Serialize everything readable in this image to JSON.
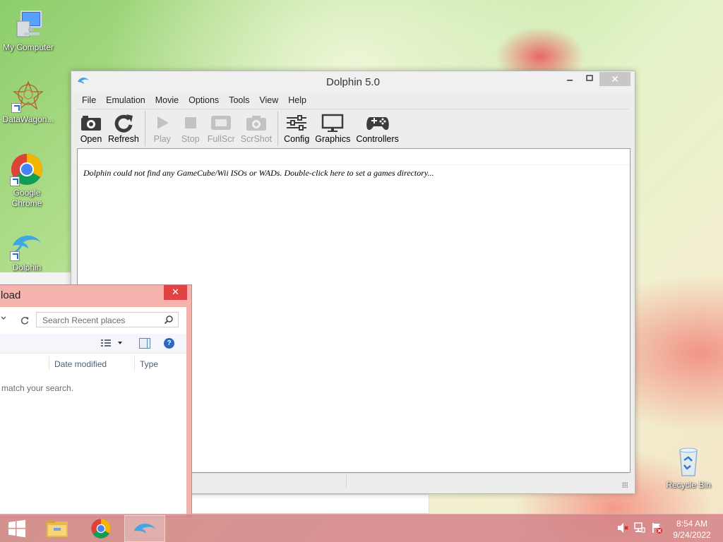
{
  "desktop": {
    "icons": [
      {
        "label": "My Computer"
      },
      {
        "label": "DataWagon..."
      },
      {
        "label": "Google Chrome"
      },
      {
        "label": "Dolphin"
      },
      {
        "label": "Recycle Bin"
      }
    ]
  },
  "dolphin_window": {
    "title": "Dolphin 5.0",
    "menu": [
      "File",
      "Emulation",
      "Movie",
      "Options",
      "Tools",
      "View",
      "Help"
    ],
    "toolbar": [
      {
        "label": "Open",
        "icon": "camera-open-icon",
        "enabled": true
      },
      {
        "label": "Refresh",
        "icon": "refresh-icon",
        "enabled": true
      },
      {
        "label": "Play",
        "icon": "play-icon",
        "enabled": false
      },
      {
        "label": "Stop",
        "icon": "stop-icon",
        "enabled": false
      },
      {
        "label": "FullScr",
        "icon": "fullscreen-icon",
        "enabled": false
      },
      {
        "label": "ScrShot",
        "icon": "screenshot-icon",
        "enabled": false
      },
      {
        "label": "Config",
        "icon": "config-sliders-icon",
        "enabled": true
      },
      {
        "label": "Graphics",
        "icon": "monitor-icon",
        "enabled": true
      },
      {
        "label": "Controllers",
        "icon": "gamepad-icon",
        "enabled": true
      }
    ],
    "gamelist_message": "Dolphin could not find any GameCube/Wii ISOs or WADs. Double-click here to set a games directory..."
  },
  "explorer_window": {
    "title": "load",
    "search_placeholder": "Search Recent places",
    "columns": [
      "Date modified",
      "Type"
    ],
    "empty_message": "ns match your search."
  },
  "taskbar": {
    "clock_time": "8:54 AM",
    "clock_date": "9/24/2022"
  },
  "colors": {
    "taskbar": "#d48287",
    "explorer_frame": "#f4b3ad",
    "close_button": "#e04343"
  }
}
